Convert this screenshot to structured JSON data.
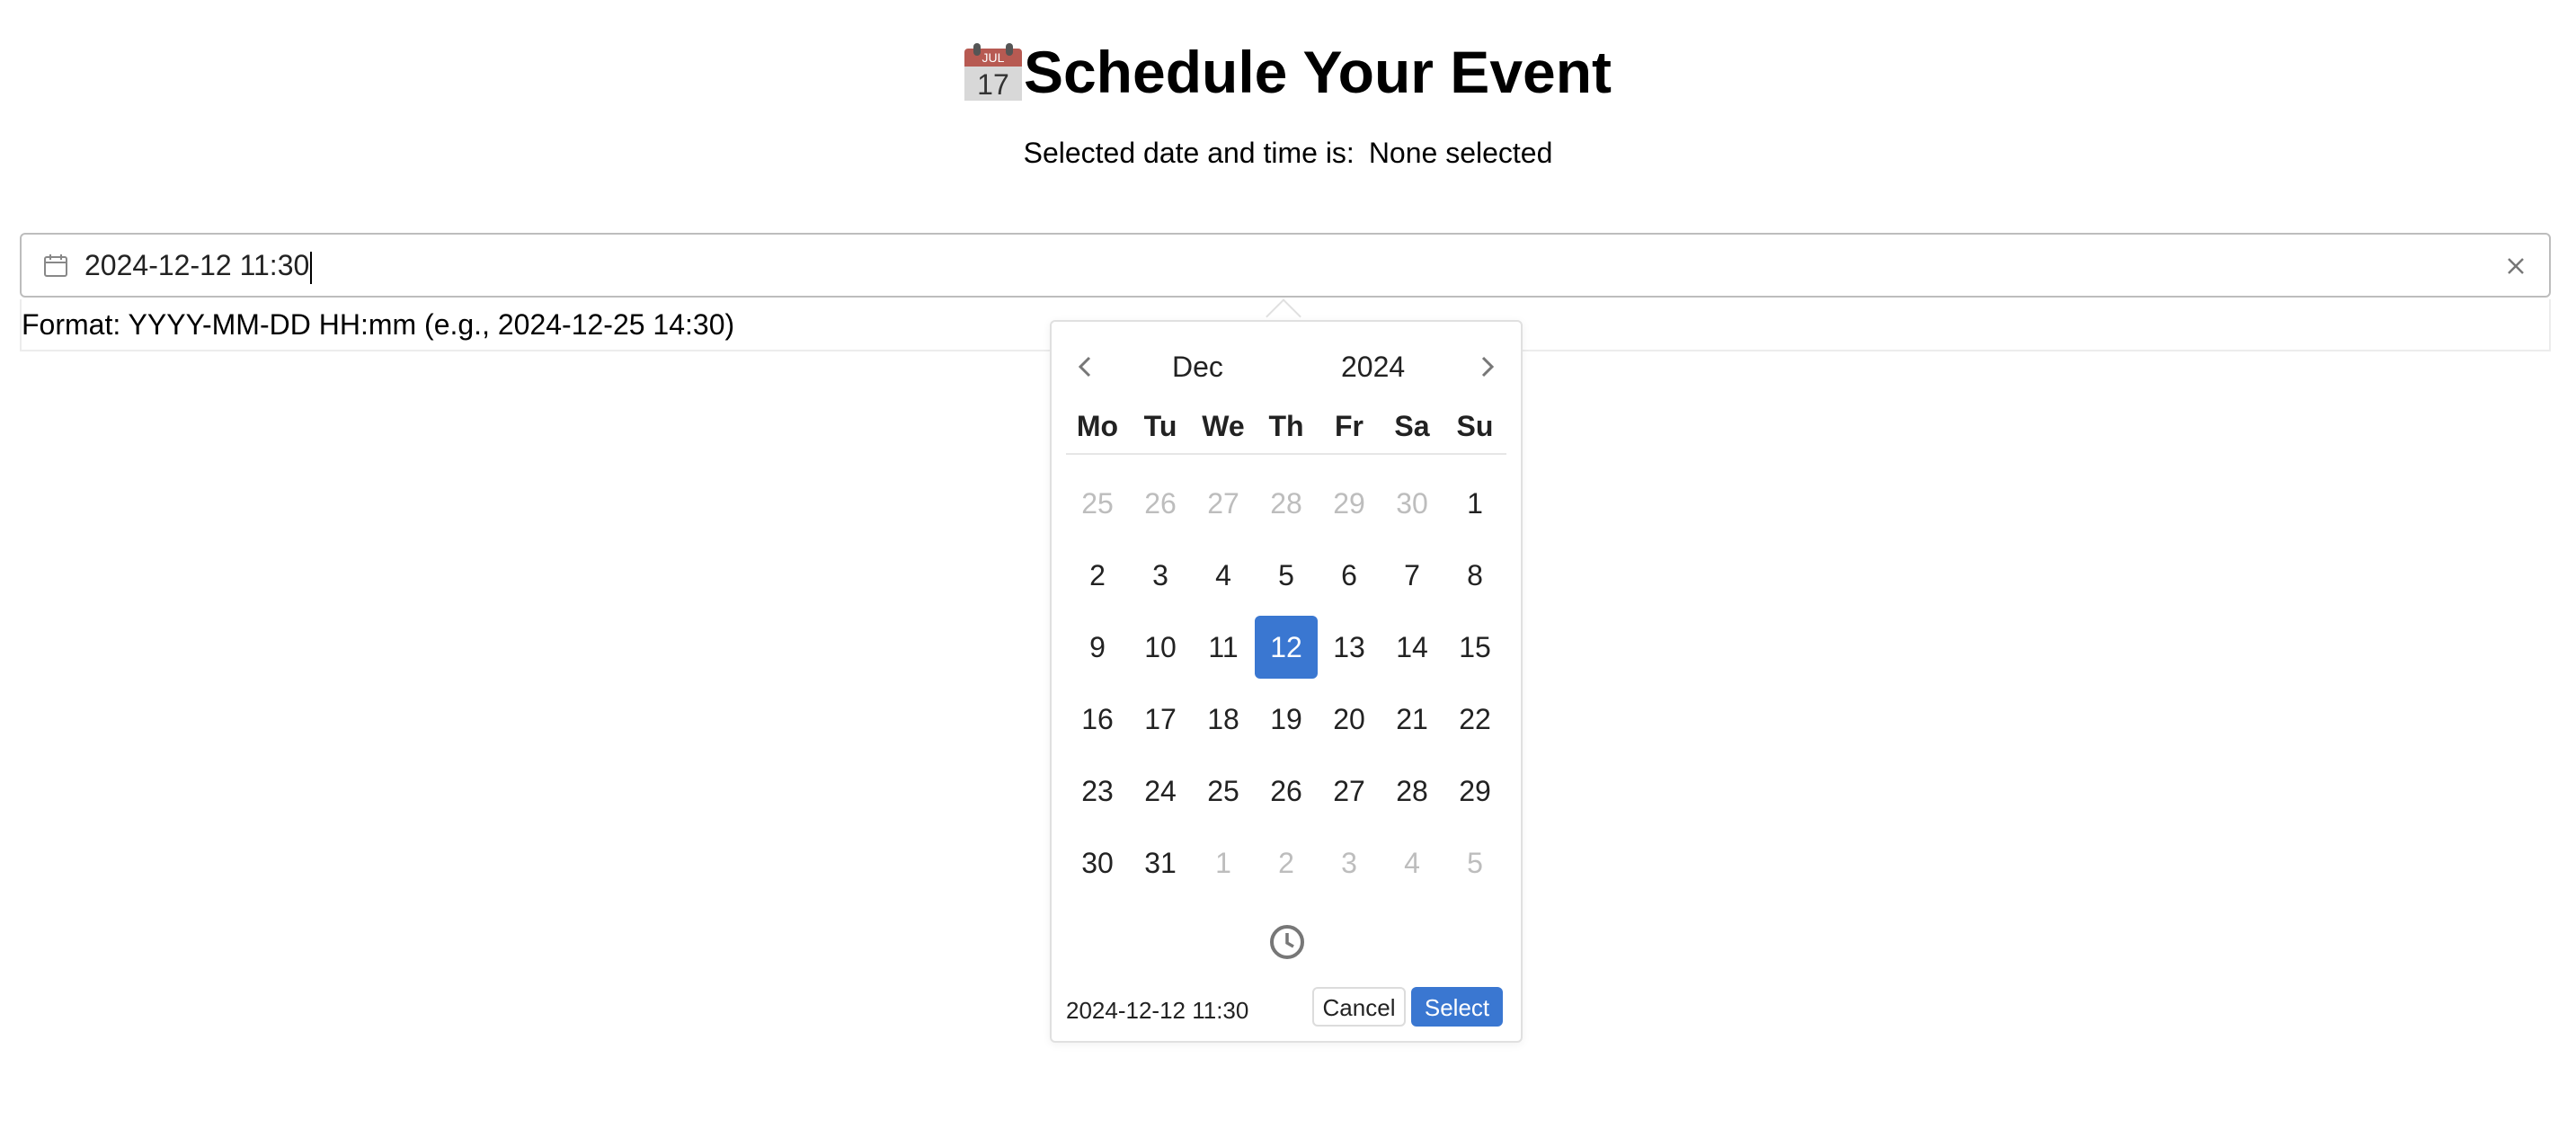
{
  "header": {
    "title": "Schedule Your Event",
    "icon": "calendar-emoji-icon",
    "icon_month": "JUL",
    "icon_day": "17"
  },
  "selected": {
    "label": "Selected date and time is:",
    "value": "None selected"
  },
  "input": {
    "value": "2024-12-12 11:30",
    "format_hint": "Format: YYYY-MM-DD HH:mm (e.g., 2024-12-25 14:30)"
  },
  "picker": {
    "month": "Dec",
    "year": "2024",
    "weekdays": [
      "Mo",
      "Tu",
      "We",
      "Th",
      "Fr",
      "Sa",
      "Su"
    ],
    "weeks": [
      [
        {
          "d": "25",
          "muted": true
        },
        {
          "d": "26",
          "muted": true
        },
        {
          "d": "27",
          "muted": true
        },
        {
          "d": "28",
          "muted": true
        },
        {
          "d": "29",
          "muted": true
        },
        {
          "d": "30",
          "muted": true
        },
        {
          "d": "1"
        }
      ],
      [
        {
          "d": "2"
        },
        {
          "d": "3"
        },
        {
          "d": "4"
        },
        {
          "d": "5"
        },
        {
          "d": "6"
        },
        {
          "d": "7"
        },
        {
          "d": "8"
        }
      ],
      [
        {
          "d": "9"
        },
        {
          "d": "10"
        },
        {
          "d": "11"
        },
        {
          "d": "12",
          "selected": true
        },
        {
          "d": "13"
        },
        {
          "d": "14"
        },
        {
          "d": "15"
        }
      ],
      [
        {
          "d": "16"
        },
        {
          "d": "17"
        },
        {
          "d": "18"
        },
        {
          "d": "19"
        },
        {
          "d": "20"
        },
        {
          "d": "21"
        },
        {
          "d": "22"
        }
      ],
      [
        {
          "d": "23"
        },
        {
          "d": "24"
        },
        {
          "d": "25"
        },
        {
          "d": "26"
        },
        {
          "d": "27"
        },
        {
          "d": "28"
        },
        {
          "d": "29"
        }
      ],
      [
        {
          "d": "30"
        },
        {
          "d": "31"
        },
        {
          "d": "1",
          "muted": true
        },
        {
          "d": "2",
          "muted": true
        },
        {
          "d": "3",
          "muted": true
        },
        {
          "d": "4",
          "muted": true
        },
        {
          "d": "5",
          "muted": true
        }
      ]
    ],
    "footer_value": "2024-12-12 11:30",
    "cancel_label": "Cancel",
    "select_label": "Select"
  },
  "colors": {
    "accent": "#3a77d1",
    "muted_text": "#bdbdbd"
  }
}
